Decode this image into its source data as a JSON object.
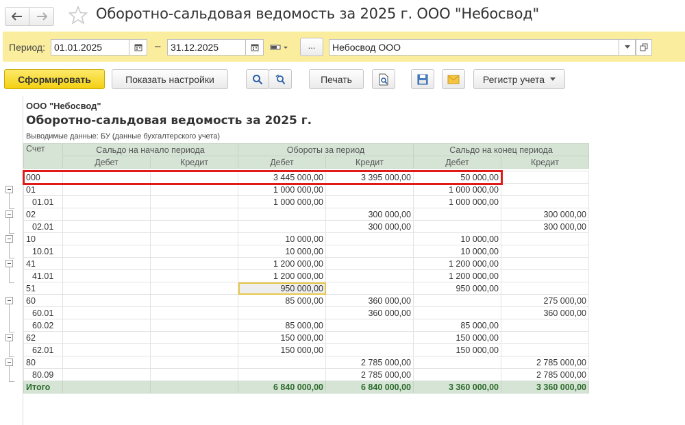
{
  "window": {
    "title": "Оборотно-сальдовая ведомость за 2025 г. ООО \"Небосвод\""
  },
  "period_bar": {
    "period_label": "Период:",
    "date_from": "01.01.2025",
    "date_sep": "–",
    "date_to": "31.12.2025",
    "dots_label": "...",
    "organization": "Небосвод ООО"
  },
  "toolbar": {
    "generate_label": "Сформировать",
    "settings_label": "Показать настройки",
    "print_label": "Печать",
    "register_label": "Регистр учета"
  },
  "report": {
    "org": "ООО \"Небосвод\"",
    "title": "Оборотно-сальдовая ведомость за 2025 г.",
    "note": "Выводимые данные: БУ (данные бухгалтерского учета)",
    "headers": {
      "account": "Счет",
      "opening": "Сальдо на начало периода",
      "turnover": "Обороты за период",
      "closing": "Сальдо на конец периода",
      "debit": "Дебет",
      "credit": "Кредит"
    },
    "rows": [
      {
        "acc": "000",
        "sub": false,
        "od": "",
        "oc": "",
        "td": "3 445 000,00",
        "tc": "3 395 000,00",
        "cd": "50 000,00",
        "cc": ""
      },
      {
        "acc": "01",
        "sub": false,
        "od": "",
        "oc": "",
        "td": "1 000 000,00",
        "tc": "",
        "cd": "1 000 000,00",
        "cc": ""
      },
      {
        "acc": "01.01",
        "sub": true,
        "od": "",
        "oc": "",
        "td": "1 000 000,00",
        "tc": "",
        "cd": "1 000 000,00",
        "cc": ""
      },
      {
        "acc": "02",
        "sub": false,
        "od": "",
        "oc": "",
        "td": "",
        "tc": "300 000,00",
        "cd": "",
        "cc": "300 000,00"
      },
      {
        "acc": "02.01",
        "sub": true,
        "od": "",
        "oc": "",
        "td": "",
        "tc": "300 000,00",
        "cd": "",
        "cc": "300 000,00"
      },
      {
        "acc": "10",
        "sub": false,
        "od": "",
        "oc": "",
        "td": "10 000,00",
        "tc": "",
        "cd": "10 000,00",
        "cc": ""
      },
      {
        "acc": "10.01",
        "sub": true,
        "od": "",
        "oc": "",
        "td": "10 000,00",
        "tc": "",
        "cd": "10 000,00",
        "cc": ""
      },
      {
        "acc": "41",
        "sub": false,
        "od": "",
        "oc": "",
        "td": "1 200 000,00",
        "tc": "",
        "cd": "1 200 000,00",
        "cc": ""
      },
      {
        "acc": "41.01",
        "sub": true,
        "od": "",
        "oc": "",
        "td": "1 200 000,00",
        "tc": "",
        "cd": "1 200 000,00",
        "cc": ""
      },
      {
        "acc": "51",
        "sub": false,
        "od": "",
        "oc": "",
        "td": "950 000,00",
        "tc": "",
        "cd": "950 000,00",
        "cc": ""
      },
      {
        "acc": "60",
        "sub": false,
        "od": "",
        "oc": "",
        "td": "85 000,00",
        "tc": "360 000,00",
        "cd": "",
        "cc": "275 000,00"
      },
      {
        "acc": "60.01",
        "sub": true,
        "od": "",
        "oc": "",
        "td": "",
        "tc": "360 000,00",
        "cd": "",
        "cc": "360 000,00"
      },
      {
        "acc": "60.02",
        "sub": true,
        "od": "",
        "oc": "",
        "td": "85 000,00",
        "tc": "",
        "cd": "85 000,00",
        "cc": ""
      },
      {
        "acc": "62",
        "sub": false,
        "od": "",
        "oc": "",
        "td": "150 000,00",
        "tc": "",
        "cd": "150 000,00",
        "cc": ""
      },
      {
        "acc": "62.01",
        "sub": true,
        "od": "",
        "oc": "",
        "td": "150 000,00",
        "tc": "",
        "cd": "150 000,00",
        "cc": ""
      },
      {
        "acc": "80",
        "sub": false,
        "od": "",
        "oc": "",
        "td": "",
        "tc": "2 785 000,00",
        "cd": "",
        "cc": "2 785 000,00"
      },
      {
        "acc": "80.09",
        "sub": true,
        "od": "",
        "oc": "",
        "td": "",
        "tc": "2 785 000,00",
        "cd": "",
        "cc": "2 785 000,00"
      }
    ],
    "total": {
      "acc": "Итого",
      "od": "",
      "oc": "",
      "td": "6 840 000,00",
      "tc": "6 840 000,00",
      "cd": "3 360 000,00",
      "cc": "3 360 000,00"
    }
  }
}
